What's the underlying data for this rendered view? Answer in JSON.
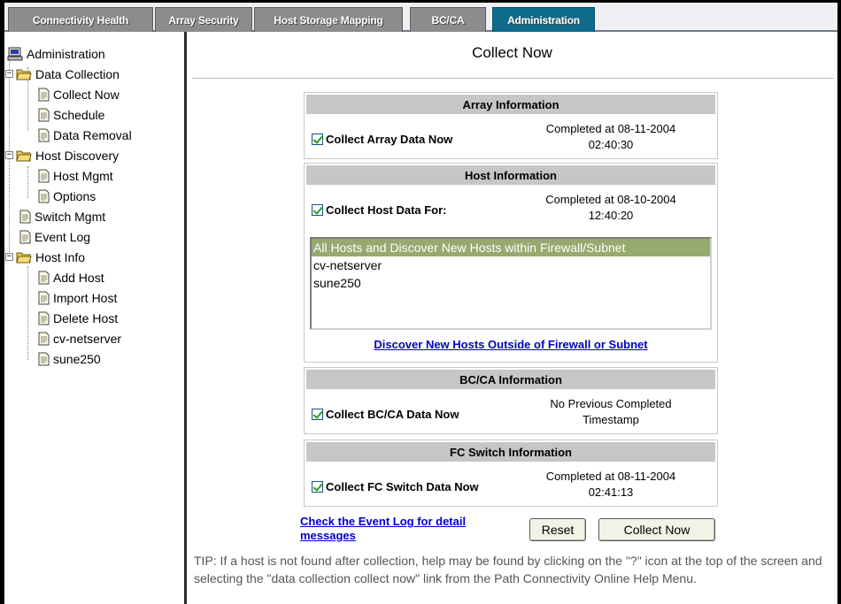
{
  "tabs": [
    {
      "label": "Connectivity Health",
      "active": false
    },
    {
      "label": "Array Security",
      "active": false
    },
    {
      "label": "Host Storage Mapping",
      "active": false
    },
    {
      "label": "BC/CA",
      "active": false
    },
    {
      "label": "Administration",
      "active": true
    }
  ],
  "tree": {
    "root": "Administration",
    "data_collection": "Data Collection",
    "collect_now": "Collect Now",
    "schedule": "Schedule",
    "data_removal": "Data Removal",
    "host_discovery": "Host Discovery",
    "host_mgmt": "Host Mgmt",
    "options": "Options",
    "switch_mgmt": "Switch Mgmt",
    "event_log": "Event Log",
    "host_info": "Host Info",
    "add_host": "Add Host",
    "import_host": "Import Host",
    "delete_host": "Delete Host",
    "cv_netserver": "cv-netserver",
    "sune250": "sune250"
  },
  "page": {
    "title": "Collect Now"
  },
  "array": {
    "header": "Array Information",
    "checkbox_label": "Collect Array Data Now",
    "status_line1": "Completed at 08-11-2004",
    "status_line2": "02:40:30"
  },
  "host": {
    "header": "Host Information",
    "checkbox_label": "Collect Host Data For:",
    "status_line1": "Completed at 08-10-2004",
    "status_line2": "12:40:20",
    "options": [
      "All Hosts and Discover New Hosts within Firewall/Subnet",
      "cv-netserver",
      "sune250"
    ],
    "discover_link": "Discover New Hosts Outside of Firewall or Subnet"
  },
  "bcca": {
    "header": "BC/CA Information",
    "checkbox_label": "Collect BC/CA Data Now",
    "status_line1": "No Previous Completed",
    "status_line2": "Timestamp"
  },
  "fcswitch": {
    "header": "FC Switch Information",
    "checkbox_label": "Collect FC Switch Data Now",
    "status_line1": "Completed at 08-11-2004",
    "status_line2": "02:41:13"
  },
  "footer": {
    "event_log_link_line1": "Check the Event Log for detail",
    "event_log_link_line2": "messages",
    "reset_label": "Reset",
    "collect_label": "Collect Now"
  },
  "tip": "TIP: If a host is not found after collection, help may be found by clicking on the \"?\" icon at the top of the screen and selecting the \"data collection collect now\" link from the Path Connectivity Online Help Menu.",
  "colors": {
    "active_tab": "#0f6b8a",
    "inactive_tab": "#8c8c8c",
    "section_header": "#c6c6c6",
    "selected_option": "#97a96f",
    "link": "#0000cc"
  }
}
